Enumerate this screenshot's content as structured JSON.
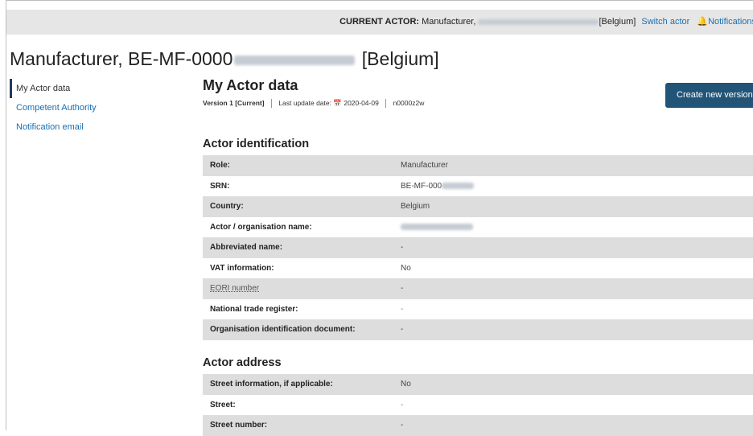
{
  "topbar": {
    "current_actor_label": "CURRENT ACTOR:",
    "current_actor_role": "Manufacturer,",
    "current_actor_country": "[Belgium]",
    "switch_actor": "Switch actor",
    "notifications": "Notifications"
  },
  "page_title": {
    "prefix": "Manufacturer, BE-MF-0000",
    "country": "[Belgium]"
  },
  "sidenav": {
    "items": [
      {
        "label": "My Actor data",
        "active": true
      },
      {
        "label": "Competent Authority",
        "active": false
      },
      {
        "label": "Notification email",
        "active": false
      }
    ]
  },
  "main": {
    "heading": "My Actor data",
    "version": "Version 1",
    "version_status": "[Current]",
    "last_update_label": "Last update date:",
    "last_update_date": "2020-04-09",
    "code": "n0000z2w",
    "create_button": "Create new version"
  },
  "sections": {
    "identification": {
      "title": "Actor identification",
      "rows": [
        {
          "label": "Role:",
          "value": "Manufacturer"
        },
        {
          "label": "SRN:",
          "value": "BE-MF-000"
        },
        {
          "label": "Country:",
          "value": "Belgium"
        },
        {
          "label": "Actor / organisation name:",
          "value": ""
        },
        {
          "label": "Abbreviated name:",
          "value": "-"
        },
        {
          "label": "VAT information:",
          "value": "No"
        },
        {
          "label": "EORI number",
          "value": "-"
        },
        {
          "label": "National trade register:",
          "value": "-"
        },
        {
          "label": "Organisation identification document:",
          "value": "-"
        }
      ]
    },
    "address": {
      "title": "Actor address",
      "rows": [
        {
          "label": "Street information, if applicable:",
          "value": "No"
        },
        {
          "label": "Street:",
          "value": "-"
        },
        {
          "label": "Street number:",
          "value": "-"
        }
      ]
    }
  },
  "colors": {
    "primary_button": "#215477",
    "link": "#1a6fb0",
    "notification_icon": "#f07a1e"
  }
}
